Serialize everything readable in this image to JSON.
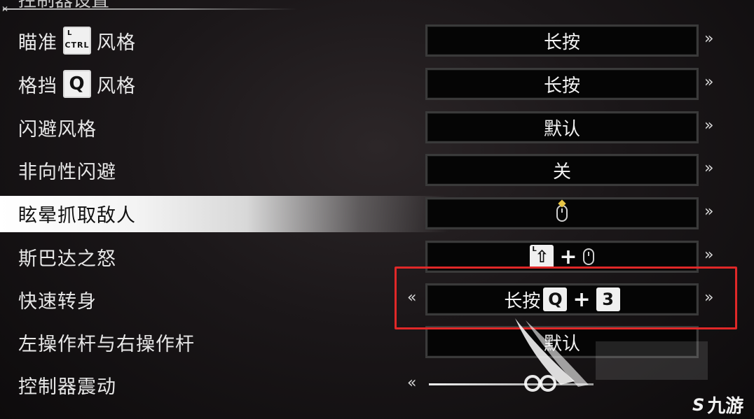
{
  "header": {
    "title": "控制器设置"
  },
  "rows": [
    {
      "label": "瞄准",
      "label_suffix": "风格",
      "key": "CTRL",
      "key_corner": "L",
      "value": "长按"
    },
    {
      "label": "格挡",
      "label_suffix": "风格",
      "key": "Q",
      "value": "长按"
    },
    {
      "label": "闪避风格",
      "value": "默认"
    },
    {
      "label": "非向性闪避",
      "value": "关"
    },
    {
      "label": "眩晕抓取敌人",
      "value_icon": "mouse-scroll-icon"
    },
    {
      "label": "斯巴达之怒",
      "value_icon": "shift-plus-mouse",
      "shift_corner": "L",
      "shift_symbol": "⇧",
      "plus": "+"
    },
    {
      "label": "快速转身",
      "value_prefix": "长按",
      "combo_key1": "Q",
      "plus": "+",
      "combo_key2": "3"
    },
    {
      "label": "左操作杆与右操作杆",
      "value": "默认"
    },
    {
      "label": "控制器震动"
    }
  ],
  "arrows": {
    "left": "«",
    "right": "»"
  },
  "watermark": {
    "text": "九游",
    "symbol": "S"
  },
  "colors": {
    "highlight": "#ffffff",
    "frame": "#e02828",
    "box_bg": "#050505"
  }
}
